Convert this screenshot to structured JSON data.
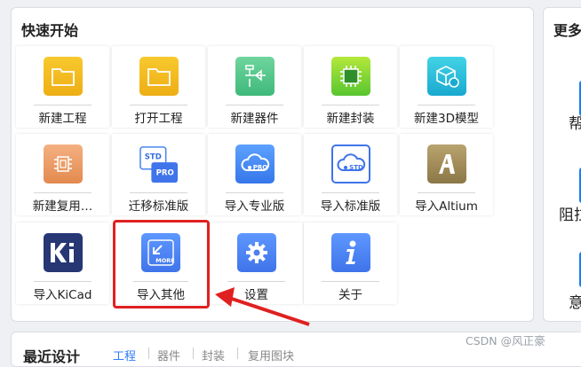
{
  "quick_start": {
    "title": "快速开始",
    "tiles": [
      {
        "label": "新建工程",
        "icon": "folder-icon"
      },
      {
        "label": "打开工程",
        "icon": "folder-icon"
      },
      {
        "label": "新建器件",
        "icon": "schematic-icon"
      },
      {
        "label": "新建封装",
        "icon": "chip-icon"
      },
      {
        "label": "新建3D模型",
        "icon": "cube-icon"
      },
      {
        "label": "新建复用…",
        "icon": "reuse-chip-icon"
      },
      {
        "label": "迁移标准版",
        "icon": "std-pro-migrate-icon"
      },
      {
        "label": "导入专业版",
        "icon": "cloud-pro-icon"
      },
      {
        "label": "导入标准版",
        "icon": "cloud-std-icon"
      },
      {
        "label": "导入Altium",
        "icon": "altium-logo-icon"
      },
      {
        "label": "导入KiCad",
        "icon": "kicad-logo-icon"
      },
      {
        "label": "导入其他",
        "icon": "import-more-icon"
      },
      {
        "label": "设置",
        "icon": "gear-icon"
      },
      {
        "label": "关于",
        "icon": "info-icon"
      }
    ]
  },
  "more": {
    "title": "更多",
    "items": [
      "帮",
      "阻拉",
      "意"
    ]
  },
  "recent": {
    "title": "最近设计",
    "tabs": [
      "工程",
      "器件",
      "封装",
      "复用图块"
    ]
  },
  "watermark": "CSDN @风正豪",
  "colors": {
    "accent": "#2f7cf6",
    "highlight": "#e02020"
  }
}
